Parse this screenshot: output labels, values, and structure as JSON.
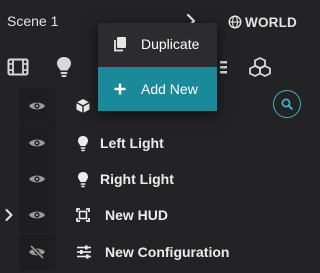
{
  "header": {
    "scene_title": "Scene 1",
    "world_label": "WORLD"
  },
  "toolbar": {
    "icons": [
      "film-icon",
      "lightbulb-icon",
      "list-icon",
      "cubes-icon"
    ]
  },
  "tree": {
    "rows": [
      {
        "label": "",
        "icon": "cube-icon",
        "visible": true
      },
      {
        "label": "Left Light",
        "icon": "lightbulb-icon",
        "visible": true
      },
      {
        "label": "Right Light",
        "icon": "lightbulb-icon",
        "visible": true
      },
      {
        "label": "New HUD",
        "icon": "hud-icon",
        "visible": true,
        "expandable": true
      },
      {
        "label": "New Configuration",
        "icon": "sliders-icon",
        "visible": false
      }
    ]
  },
  "context_menu": {
    "items": [
      {
        "label": "Duplicate",
        "icon": "copy-icon"
      },
      {
        "label": "Add New",
        "icon": "plus-icon",
        "highlighted": true
      }
    ]
  },
  "colors": {
    "background": "#232325",
    "eye_column": "#1e1e20",
    "accent": "#1a8a9a",
    "search_ring": "#3fb2c4",
    "popup": "#2c2c2e"
  }
}
